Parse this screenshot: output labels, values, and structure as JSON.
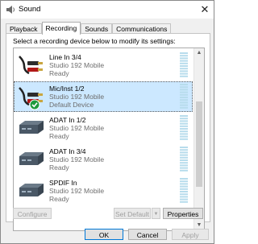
{
  "window": {
    "title": "Sound",
    "close_glyph": "✕"
  },
  "tabs": [
    {
      "label": "Playback",
      "active": false
    },
    {
      "label": "Recording",
      "active": true
    },
    {
      "label": "Sounds",
      "active": false
    },
    {
      "label": "Communications",
      "active": false
    }
  ],
  "instruction": "Select a recording device below to modify its settings:",
  "devices": [
    {
      "name": "Line In 3/4",
      "subtitle": "Studio 192 Mobile",
      "status": "Ready",
      "icon": "line-in-cable-icon",
      "selected": false,
      "default": false
    },
    {
      "name": "Mic/Inst 1/2",
      "subtitle": "Studio 192 Mobile",
      "status": "Default Device",
      "icon": "line-in-cable-icon",
      "selected": true,
      "default": true
    },
    {
      "name": "ADAT In 1/2",
      "subtitle": "Studio 192 Mobile",
      "status": "Ready",
      "icon": "digital-device-icon",
      "selected": false,
      "default": false
    },
    {
      "name": "ADAT In 3/4",
      "subtitle": "Studio 192 Mobile",
      "status": "Ready",
      "icon": "digital-device-icon",
      "selected": false,
      "default": false
    },
    {
      "name": "SPDIF In",
      "subtitle": "Studio 192 Mobile",
      "status": "Ready",
      "icon": "digital-device-icon",
      "selected": false,
      "default": false
    }
  ],
  "buttons": {
    "configure": "Configure",
    "set_default": "Set Default",
    "set_default_arrow": "▼",
    "properties": "Properties",
    "ok": "OK",
    "cancel": "Cancel",
    "apply": "Apply"
  },
  "scrollbar": {
    "up_glyph": "▲",
    "down_glyph": "▼"
  },
  "colors": {
    "selection": "#cce8ff",
    "meter": "#b7dcec",
    "check": "#1e9a3c"
  }
}
